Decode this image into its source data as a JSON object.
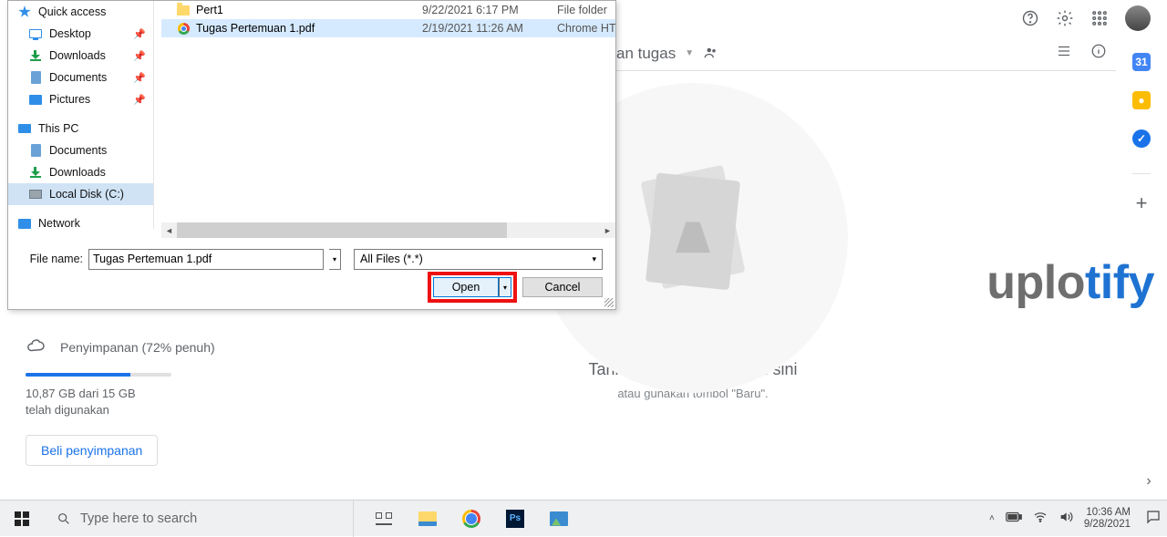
{
  "dialog": {
    "nav": {
      "quick_access": "Quick access",
      "desktop": "Desktop",
      "downloads": "Downloads",
      "documents": "Documents",
      "pictures": "Pictures",
      "this_pc": "This PC",
      "documents2": "Documents",
      "downloads2": "Downloads",
      "local_disk": "Local Disk (C:)",
      "network": "Network"
    },
    "files": [
      {
        "name": "Pert1",
        "date": "9/22/2021 6:17 PM",
        "type": "File folder",
        "icon": "folder"
      },
      {
        "name": "Tugas Pertemuan 1.pdf",
        "date": "2/19/2021 11:26 AM",
        "type": "Chrome HTML D",
        "icon": "chrome",
        "selected": true
      }
    ],
    "filename_label": "File name:",
    "filename_value": "Tugas Pertemuan 1.pdf",
    "filetype_value": "All Files (*.*)",
    "open_label": "Open",
    "cancel_label": "Cancel"
  },
  "drive": {
    "sub_label": "an tugas",
    "drop_text1": "Tarik dan lepaskan file di sini",
    "drop_text2": "atau gunakan tombol \"Baru\"."
  },
  "storage": {
    "title": "Penyimpanan (72% penuh)",
    "detail": "10,87 GB dari 15 GB telah digunakan",
    "buy": "Beli penyimpanan"
  },
  "brand": {
    "pre": "uplo",
    "ti": "ti",
    "fy": "fy"
  },
  "taskbar": {
    "search_placeholder": "Type here to search",
    "time": "10:36 AM",
    "date": "9/28/2021"
  },
  "sidepanel": {
    "cal": "31"
  }
}
